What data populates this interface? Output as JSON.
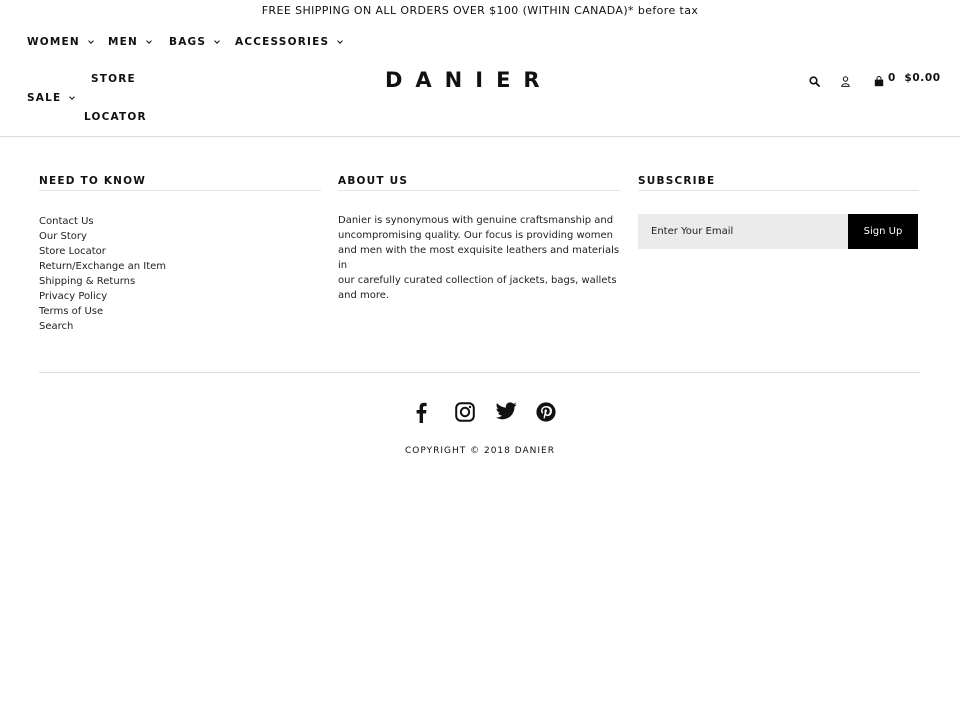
{
  "announcement": "FREE SHIPPING ON ALL ORDERS OVER $100 (WITHIN CANADA)* before tax",
  "nav": {
    "women": "WOMEN",
    "men": "MEN",
    "bags": "BAGS",
    "accessories": "ACCESSORIES",
    "store_line1": "STORE",
    "store_line2": "LOCATOR",
    "sale": "SALE"
  },
  "logo": "DANIER",
  "header_icons": [
    "search-icon",
    "user-icon",
    "cart-icon"
  ],
  "cart": {
    "count": "0",
    "total": "$0.00"
  },
  "footer": {
    "need_to_know": {
      "title": "NEED TO KNOW",
      "links": [
        "Contact Us",
        "Our Story",
        "Store Locator",
        "Return/Exchange an Item",
        "Shipping & Returns",
        "Privacy Policy",
        "Terms of Use",
        "Search"
      ]
    },
    "about": {
      "title": "ABOUT US",
      "text": "Danier is synonymous with genuine craftsmanship and\nuncompromising quality.  Our focus is providing women\nand men with the most exquisite leathers and materials in\nour carefully curated collection of jackets, bags, wallets\nand more."
    },
    "subscribe": {
      "title": "SUBSCRIBE",
      "placeholder": "Enter Your Email",
      "button": "Sign Up"
    },
    "social_icons": [
      "facebook-icon",
      "instagram-icon",
      "twitter-icon",
      "pinterest-icon"
    ],
    "copyright": "COPYRIGHT © 2018 DANIER"
  },
  "colors": {
    "text": "#111111",
    "button_bg": "#000000",
    "input_bg": "#ebebeb",
    "rule": "#dcdcdc"
  }
}
